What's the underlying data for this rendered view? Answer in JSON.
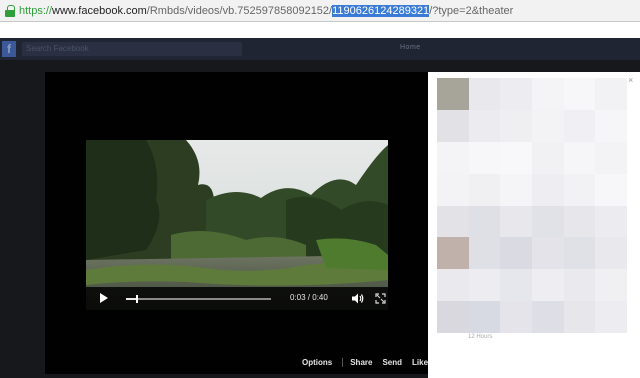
{
  "browser": {
    "url_protocol": "https://",
    "url_host": "www.facebook.com",
    "url_path_before": "/Rmbds/videos/vb.752597858092152/",
    "url_selected": "1190626124289321",
    "url_path_after": "/?type=2&theater"
  },
  "facebook_header": {
    "logo": "f",
    "search_placeholder": "Search Facebook",
    "nav_text": "Home"
  },
  "player": {
    "time_display": "0:03 / 0:40",
    "progress": 0.075,
    "icons": [
      "play-icon",
      "volume-icon",
      "fullscreen-icon"
    ]
  },
  "actions": {
    "options": "Options",
    "share": "Share",
    "send": "Send",
    "like": "Like"
  },
  "side_panel": {
    "close": "×",
    "caption": "12 Hours"
  },
  "colors": {
    "url_secure": "#2e9f3a",
    "url_selection": "#3a7bd5",
    "fb_header": "#1f2533",
    "stage": "#010101"
  }
}
